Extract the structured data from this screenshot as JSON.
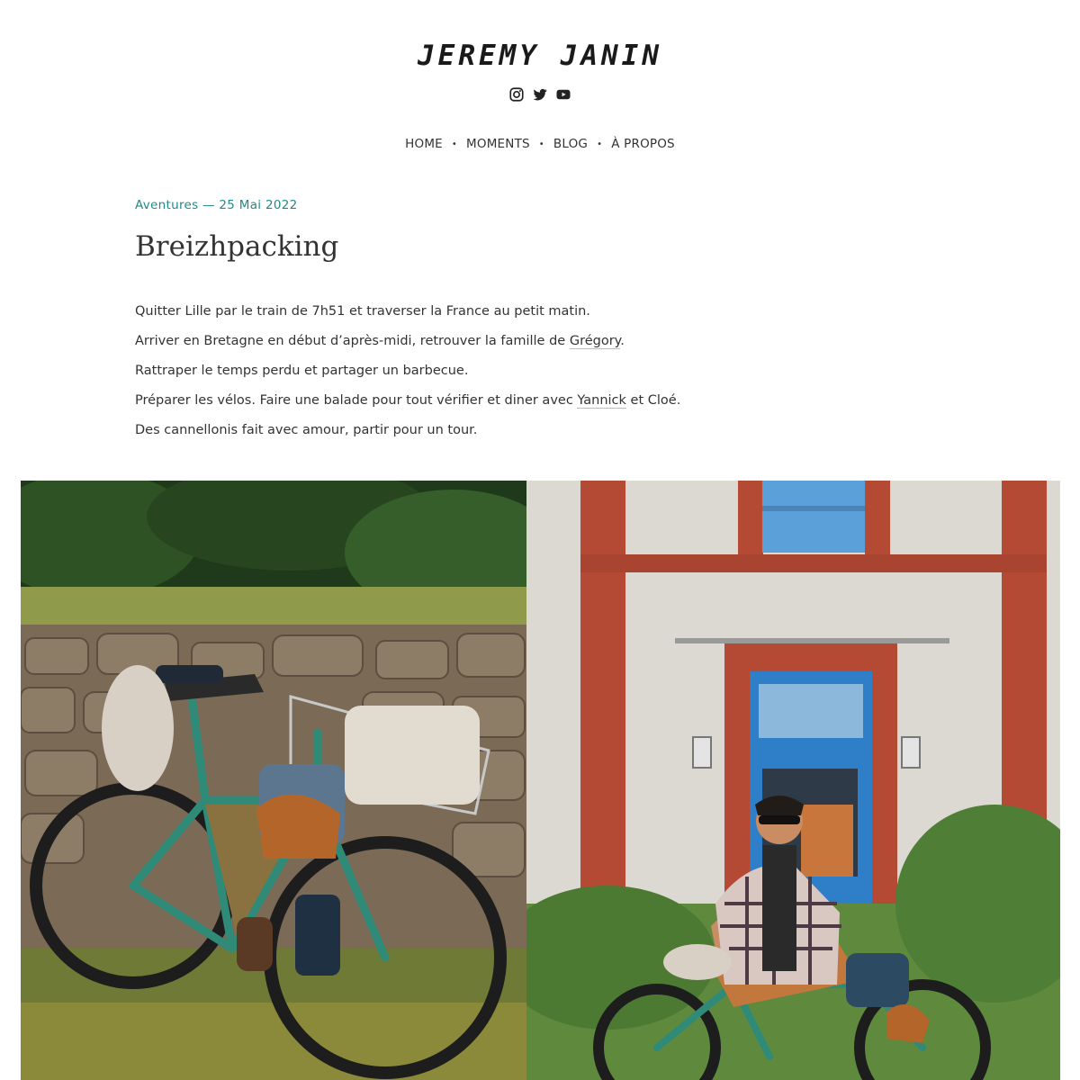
{
  "site": {
    "title": "JEREMY JANIN",
    "social": [
      {
        "name": "instagram-icon"
      },
      {
        "name": "twitter-icon"
      },
      {
        "name": "youtube-icon"
      }
    ]
  },
  "nav": {
    "items": [
      "HOME",
      "MOMENTS",
      "BLOG",
      "À PROPOS"
    ],
    "separator": "•"
  },
  "post": {
    "meta": "Aventures — 25 Mai 2022",
    "title": "Breizhpacking",
    "paragraphs": [
      {
        "before": "Quitter Lille par le train de 7h51 et traverser la France au petit matin.",
        "link": "",
        "after": ""
      },
      {
        "before": "Arriver en Bretagne en début d’après-midi, retrouver la famille de ",
        "link": "Grégory",
        "after": "."
      },
      {
        "before": "Rattraper le temps perdu et partager un barbecue.",
        "link": "",
        "after": ""
      },
      {
        "before": "Préparer les vélos. Faire une balade pour tout vérifier et diner avec ",
        "link": "Yannick",
        "after": " et Cloé."
      },
      {
        "before": "Des cannellonis fait avec amour, partir pour un tour.",
        "link": "",
        "after": ""
      }
    ]
  },
  "colors": {
    "accent": "#1f8a8a",
    "link_underline": "#8fd1c8",
    "text": "#333333"
  }
}
